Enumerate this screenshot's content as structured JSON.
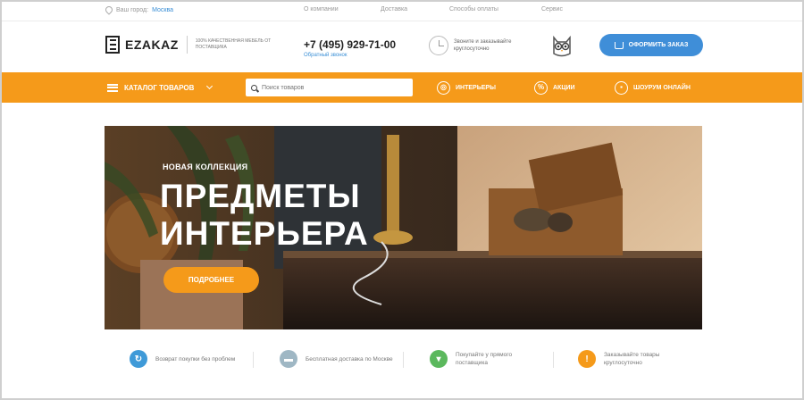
{
  "topbar": {
    "city_label": "Ваш город:",
    "city_value": "Москва",
    "links": [
      "О компании",
      "Доставка",
      "Способы оплаты",
      "Сервис"
    ]
  },
  "header": {
    "logo_text": "EZAKAZ",
    "logo_tagline": "100% КАЧЕСТВЕННАЯ МЕБЕЛЬ ОТ ПОСТАВЩИКА",
    "phone": "+7 (495) 929-71-00",
    "callback_link": "Обратный звонок",
    "call_hours": "Звоните и заказывайте круглосуточно",
    "order_button": "ОФОРМИТЬ ЗАКАЗ"
  },
  "nav": {
    "catalog_label": "КАТАЛОГ ТОВАРОВ",
    "search_placeholder": "Поиск товаров",
    "links": [
      {
        "label": "ИНТЕРЬЕРЫ",
        "icon": "globe-icon"
      },
      {
        "label": "АКЦИИ",
        "icon": "percent-icon"
      },
      {
        "label": "ШОУРУМ ОНЛАЙН",
        "icon": "camera-icon"
      }
    ]
  },
  "hero": {
    "kicker": "НОВАЯ КОЛЛЕКЦИЯ",
    "title_line1": "ПРЕДМЕТЫ",
    "title_line2": "ИНТЕРЬЕРА",
    "button": "ПОДРОБНЕЕ"
  },
  "features": [
    {
      "text": "Возврат покупки без проблем",
      "icon": "return-icon",
      "color": "#3f9ad8"
    },
    {
      "text": "Бесплатная доставка по Москве",
      "icon": "truck-icon",
      "color": "#9fb7c4"
    },
    {
      "text": "Покупайте у прямого поставщика",
      "icon": "cart-icon",
      "color": "#5bb85d"
    },
    {
      "text": "Заказывайте товары круглосуточно",
      "icon": "clock-icon",
      "color": "#f59a1a"
    }
  ],
  "colors": {
    "accent_orange": "#f59a1a",
    "accent_blue": "#3f8ed8"
  }
}
